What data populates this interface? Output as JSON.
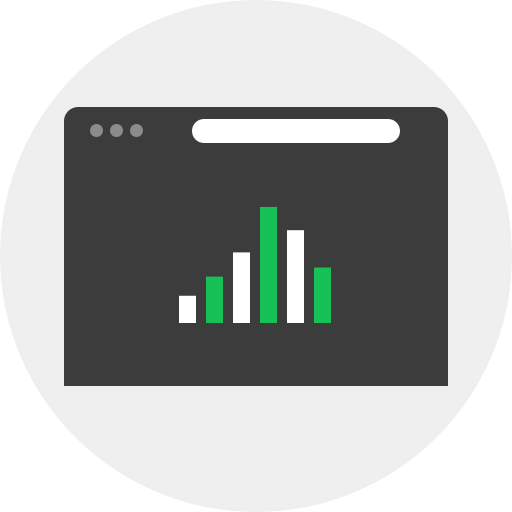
{
  "icon": {
    "name": "browser-analytics-icon",
    "colors": {
      "background_circle": "#efefef",
      "window": "#3c3c3c",
      "window_dots": "#8c8c8c",
      "address_bar": "#ffffff"
    }
  },
  "chart_data": {
    "type": "bar",
    "categories": [
      "",
      "",
      "",
      "",
      "",
      ""
    ],
    "values": [
      27,
      46,
      70,
      115,
      92,
      55
    ],
    "colors": [
      "#ffffff",
      "#18c058",
      "#ffffff",
      "#18c058",
      "#ffffff",
      "#18c058"
    ],
    "title": "",
    "xlabel": "",
    "ylabel": "",
    "ylim": [
      0,
      115
    ],
    "grid": false
  }
}
